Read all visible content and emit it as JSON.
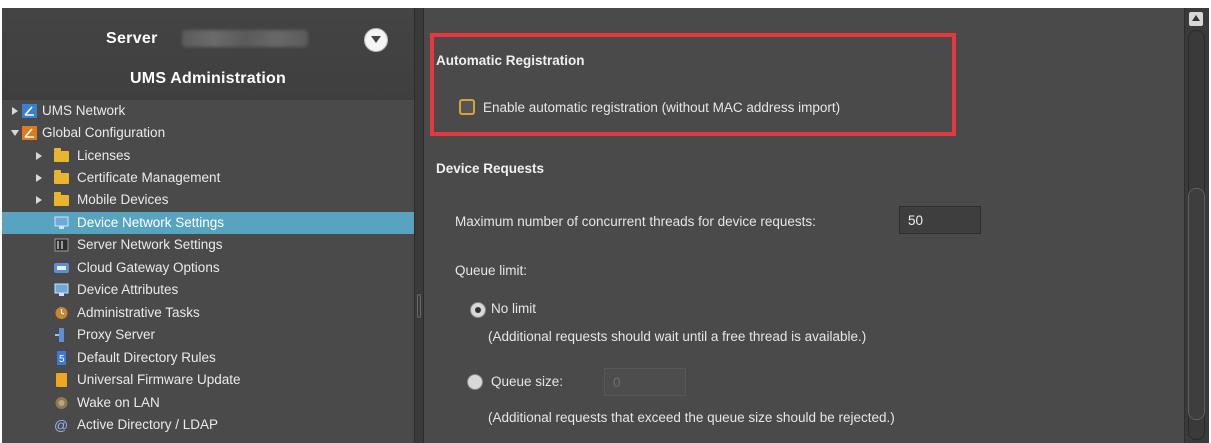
{
  "sidebar": {
    "server_label": "Server",
    "title": "UMS Administration",
    "collapse_icon": "chevron-down-icon",
    "tree": [
      {
        "label": "UMS Network",
        "icon": "ums-network-icon",
        "level": 0,
        "expander": "collapsed"
      },
      {
        "label": "Global Configuration",
        "icon": "global-config-icon",
        "level": 0,
        "expander": "expanded"
      },
      {
        "label": "Licenses",
        "icon": "folder-icon",
        "level": 1,
        "expander": "collapsed"
      },
      {
        "label": "Certificate Management",
        "icon": "folder-icon",
        "level": 1,
        "expander": "collapsed"
      },
      {
        "label": "Mobile Devices",
        "icon": "folder-icon",
        "level": 1,
        "expander": "collapsed"
      },
      {
        "label": "Device Network Settings",
        "icon": "monitor-icon",
        "level": 1,
        "selected": true
      },
      {
        "label": "Server Network Settings",
        "icon": "server-icon",
        "level": 1
      },
      {
        "label": "Cloud Gateway Options",
        "icon": "cloud-gateway-icon",
        "level": 1
      },
      {
        "label": "Device Attributes",
        "icon": "monitor-icon",
        "level": 1
      },
      {
        "label": "Administrative Tasks",
        "icon": "clock-icon",
        "level": 1
      },
      {
        "label": "Proxy Server",
        "icon": "proxy-icon",
        "level": 1
      },
      {
        "label": "Default Directory Rules",
        "icon": "rules-icon",
        "level": 1
      },
      {
        "label": "Universal Firmware Update",
        "icon": "firmware-icon",
        "level": 1
      },
      {
        "label": "Wake on LAN",
        "icon": "wake-icon",
        "level": 1
      },
      {
        "label": "Active Directory / LDAP",
        "icon": "at-icon",
        "level": 1
      }
    ]
  },
  "main": {
    "auto_reg": {
      "heading": "Automatic Registration",
      "checkbox_label": "Enable automatic registration (without MAC address import)",
      "checked": false
    },
    "device_requests": {
      "heading": "Device Requests",
      "threads_label": "Maximum number of concurrent threads for device requests:",
      "threads_value": "50",
      "queue_limit_label": "Queue limit:",
      "no_limit_label": "No limit",
      "no_limit_note": "(Additional requests should wait until a free thread is available.)",
      "queue_size_label": "Queue size:",
      "queue_size_value": "0",
      "queue_size_note": "(Additional requests that exceed the queue size should be rejected.)"
    }
  },
  "colors": {
    "selection": "#58a4c0",
    "highlight_border": "#e8383f",
    "panel": "#4a4a4a",
    "checkbox_border": "#d6a33b"
  }
}
